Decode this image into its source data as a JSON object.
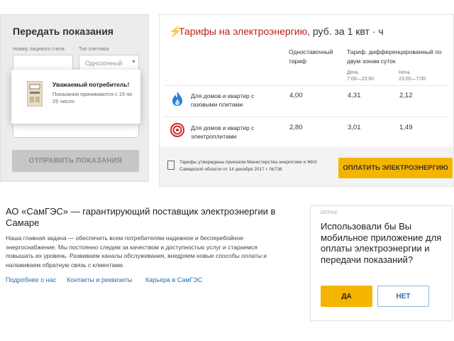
{
  "submit_readings": {
    "title": "Передать показания",
    "account_label": "Номер лицевого счета",
    "meter_type_label": "Тип счетчика",
    "meter_type_value": "Однозонный",
    "popup_title": "Уважаемый потребитель!",
    "popup_text": "Показания принимаются с 15 по 25 число",
    "send_button": "ОТПРАВИТЬ ПОКАЗАНИЯ",
    "icons": [
      "meter-icon",
      "chevron-down-icon"
    ]
  },
  "tariffs": {
    "title_accent": "Тарифы на электроэнергию",
    "title_rest": ", руб. за 1 квт · ч",
    "col_single": "Одноставочный тариф",
    "col_dual": "Тариф, дифференцированный по двум зонам суток",
    "day_label": "День",
    "day_hours": "7:00—23:00",
    "night_label": "Ночь",
    "night_hours": "23:00—7:00",
    "rows": [
      {
        "label": "Для домов и квартир с газовыми плитами",
        "single": "4,00",
        "day": "4,31",
        "night": "2,12",
        "icon": "gas-flame-icon"
      },
      {
        "label": "Для домов и квартир с электроплитами",
        "single": "2,80",
        "day": "3,01",
        "night": "1,49",
        "icon": "electric-stove-icon"
      }
    ],
    "footer_note": "Тарифы утверждены приказом Министерства энергетики и ЖКХ Самарской области от 14 декабря 2017 г. №736",
    "pay_button": "ОПЛАТИТЬ ЭЛЕКТРОЭНЕРГИЮ",
    "colors": {
      "accent": "#b8221c",
      "yellow": "#f5b400",
      "gas_blue": "#2a7fd4",
      "stove_red": "#d02a2a"
    }
  },
  "company": {
    "title": "АО «СамГЭС» — гарантирующий поставщик электроэнергии в Самаре",
    "text": "Наша главная задача — обеспечить всем потребителям надежное и бесперебойное энергоснабжение. Мы постоянно следим за качеством и доступностью услуг и стараемся повышать их уровень. Развиваем каналы обслуживания, внедряем новые способы оплаты и налаживаем обратную связь с клиентами.",
    "links": [
      "Подробнее о нас",
      "Контакты и реквизиты",
      "Карьера в СамГЭС"
    ]
  },
  "survey": {
    "label": "ОПРОС",
    "question": "Использовали бы Вы мобильное приложение для оплаты электроэнергии и передачи показаний?",
    "yes": "ДА",
    "no": "НЕТ"
  }
}
